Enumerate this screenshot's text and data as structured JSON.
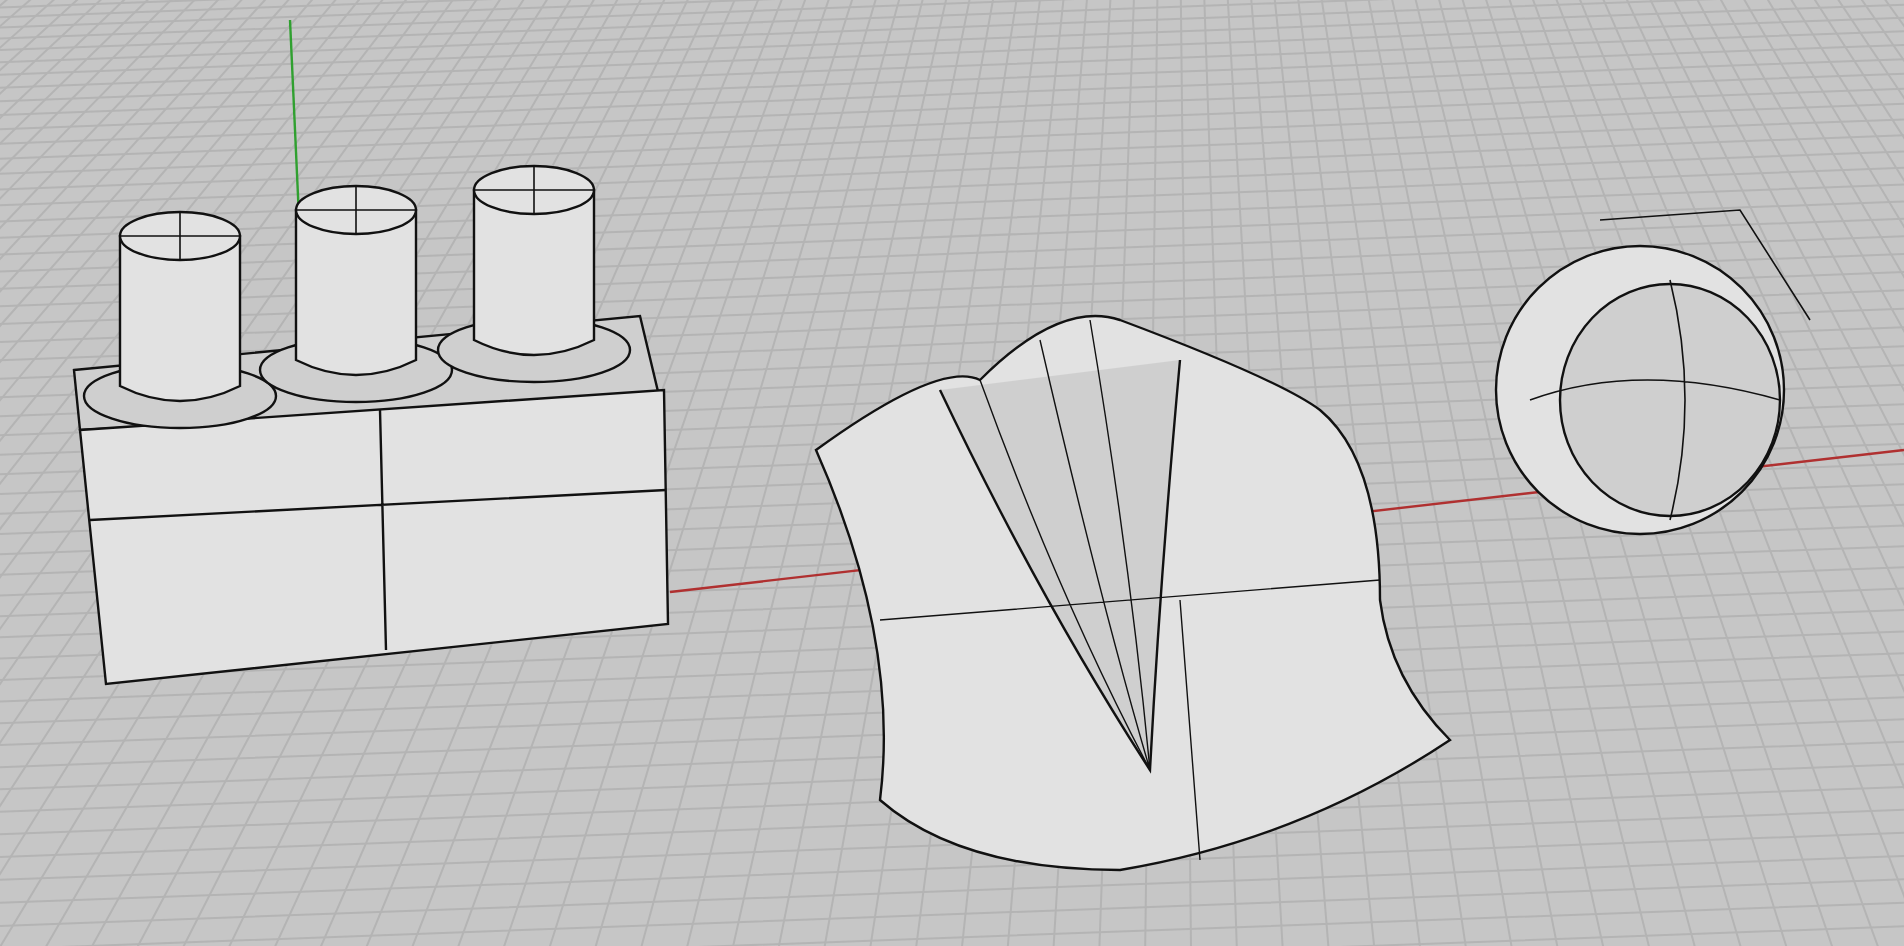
{
  "viewport": {
    "grid": true,
    "axes": true,
    "shaded": true
  }
}
